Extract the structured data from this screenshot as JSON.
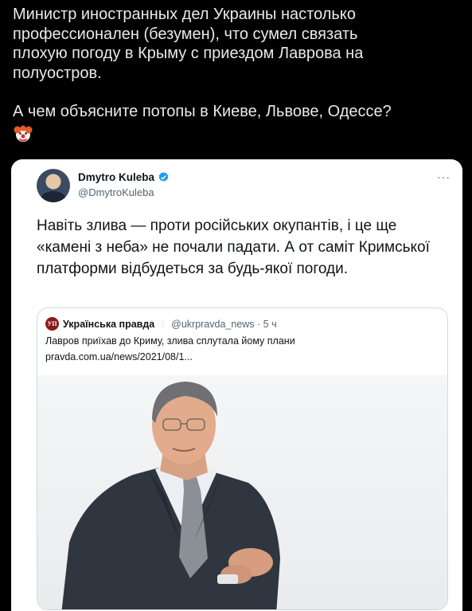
{
  "post": {
    "line1": "Министр иностранных дел Украины настолько",
    "line2": "профессионален (безумен), что сумел связать",
    "line3": "плохую погоду в Крыму с приездом Лаврова на",
    "line4": "полуостров.",
    "line5": "А чем объясните потопы в Киеве, Львове, Одессе?",
    "emoji": "clown-face-icon"
  },
  "quoted_tweet": {
    "author_name": "Dmytro Kuleba",
    "author_handle": "@DmytroKuleba",
    "more": "···",
    "body": "Навіть злива — проти російських окупантів, і це ще «камені з неба» не почали падати. А от саміт Кримської платформи відбудеться за будь-якої погоди."
  },
  "inner_quote": {
    "logo_text": "УП",
    "source_name": "Українська правда",
    "hand_emoji": "✌",
    "handle_time": "@ukrpravda_news · 5 ч",
    "headline": "Лавров приїхав до Криму, злива сплутала йому плани",
    "link": "pravda.com.ua/news/2021/08/1..."
  },
  "colors": {
    "background": "#000000",
    "text_dark": "#e7e9ea",
    "verified": "#1d9bf0",
    "secondary": "#536471"
  }
}
